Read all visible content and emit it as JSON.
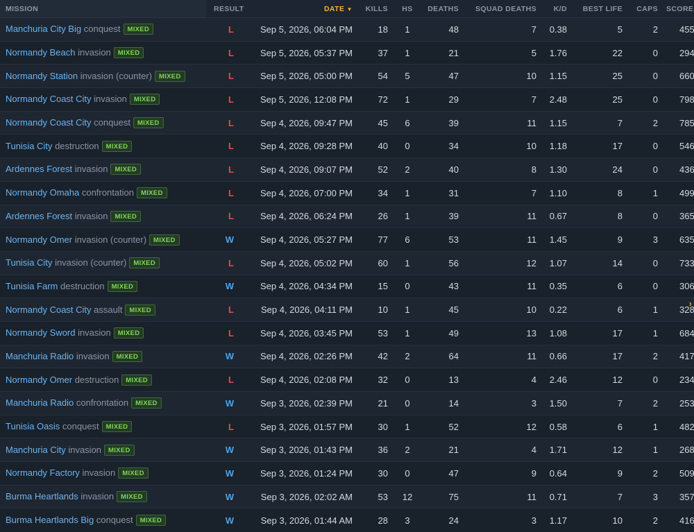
{
  "columns": {
    "mission": "MISSION",
    "result": "RESULT",
    "date": "DATE",
    "date_sort_icon": "sort-down-icon",
    "kills": "KILLS",
    "hs": "HS",
    "deaths": "DEATHS",
    "squad_deaths": "SQUAD DEATHS",
    "kd": "K/D",
    "best_life": "BEST LIFE",
    "caps": "CAPS",
    "score": "SCORE"
  },
  "badge_label": "MIXED",
  "colors": {
    "loss": "#e84b4b",
    "win": "#4da3ea",
    "accent": "#f0b232",
    "map_link": "#6cb4f0",
    "badge": "#7ed957"
  },
  "rows": [
    {
      "map": "Manchuria City Big",
      "mode": "conquest",
      "result": "L",
      "date": "Sep 5, 2026, 06:04 PM",
      "kills": "18",
      "hs": "1",
      "deaths": "48",
      "squad_deaths": "7",
      "kd": "0.38",
      "best_life": "5",
      "caps": "2",
      "score": "455"
    },
    {
      "map": "Normandy Beach",
      "mode": "invasion",
      "result": "L",
      "date": "Sep 5, 2026, 05:37 PM",
      "kills": "37",
      "hs": "1",
      "deaths": "21",
      "squad_deaths": "5",
      "kd": "1.76",
      "best_life": "22",
      "caps": "0",
      "score": "294"
    },
    {
      "map": "Normandy Station",
      "mode": "invasion (counter)",
      "result": "L",
      "date": "Sep 5, 2026, 05:00 PM",
      "kills": "54",
      "hs": "5",
      "deaths": "47",
      "squad_deaths": "10",
      "kd": "1.15",
      "best_life": "25",
      "caps": "0",
      "score": "660"
    },
    {
      "map": "Normandy Coast City",
      "mode": "invasion",
      "result": "L",
      "date": "Sep 5, 2026, 12:08 PM",
      "kills": "72",
      "hs": "1",
      "deaths": "29",
      "squad_deaths": "7",
      "kd": "2.48",
      "best_life": "25",
      "caps": "0",
      "score": "798"
    },
    {
      "map": "Normandy Coast City",
      "mode": "conquest",
      "result": "L",
      "date": "Sep 4, 2026, 09:47 PM",
      "kills": "45",
      "hs": "6",
      "deaths": "39",
      "squad_deaths": "11",
      "kd": "1.15",
      "best_life": "7",
      "caps": "2",
      "score": "785"
    },
    {
      "map": "Tunisia City",
      "mode": "destruction",
      "result": "L",
      "date": "Sep 4, 2026, 09:28 PM",
      "kills": "40",
      "hs": "0",
      "deaths": "34",
      "squad_deaths": "10",
      "kd": "1.18",
      "best_life": "17",
      "caps": "0",
      "score": "546"
    },
    {
      "map": "Ardennes Forest",
      "mode": "invasion",
      "result": "L",
      "date": "Sep 4, 2026, 09:07 PM",
      "kills": "52",
      "hs": "2",
      "deaths": "40",
      "squad_deaths": "8",
      "kd": "1.30",
      "best_life": "24",
      "caps": "0",
      "score": "436"
    },
    {
      "map": "Normandy Omaha",
      "mode": "confrontation",
      "result": "L",
      "date": "Sep 4, 2026, 07:00 PM",
      "kills": "34",
      "hs": "1",
      "deaths": "31",
      "squad_deaths": "7",
      "kd": "1.10",
      "best_life": "8",
      "caps": "1",
      "score": "499"
    },
    {
      "map": "Ardennes Forest",
      "mode": "invasion",
      "result": "L",
      "date": "Sep 4, 2026, 06:24 PM",
      "kills": "26",
      "hs": "1",
      "deaths": "39",
      "squad_deaths": "11",
      "kd": "0.67",
      "best_life": "8",
      "caps": "0",
      "score": "365"
    },
    {
      "map": "Normandy Omer",
      "mode": "invasion (counter)",
      "result": "W",
      "date": "Sep 4, 2026, 05:27 PM",
      "kills": "77",
      "hs": "6",
      "deaths": "53",
      "squad_deaths": "11",
      "kd": "1.45",
      "best_life": "9",
      "caps": "3",
      "score": "635"
    },
    {
      "map": "Tunisia City",
      "mode": "invasion (counter)",
      "result": "L",
      "date": "Sep 4, 2026, 05:02 PM",
      "kills": "60",
      "hs": "1",
      "deaths": "56",
      "squad_deaths": "12",
      "kd": "1.07",
      "best_life": "14",
      "caps": "0",
      "score": "733"
    },
    {
      "map": "Tunisia Farm",
      "mode": "destruction",
      "result": "W",
      "date": "Sep 4, 2026, 04:34 PM",
      "kills": "15",
      "hs": "0",
      "deaths": "43",
      "squad_deaths": "11",
      "kd": "0.35",
      "best_life": "6",
      "caps": "0",
      "score": "306"
    },
    {
      "map": "Normandy Coast City",
      "mode": "assault",
      "result": "L",
      "date": "Sep 4, 2026, 04:11 PM",
      "kills": "10",
      "hs": "1",
      "deaths": "45",
      "squad_deaths": "10",
      "kd": "0.22",
      "best_life": "6",
      "caps": "1",
      "score": "328"
    },
    {
      "map": "Normandy Sword",
      "mode": "invasion",
      "result": "L",
      "date": "Sep 4, 2026, 03:45 PM",
      "kills": "53",
      "hs": "1",
      "deaths": "49",
      "squad_deaths": "13",
      "kd": "1.08",
      "best_life": "17",
      "caps": "1",
      "score": "684"
    },
    {
      "map": "Manchuria Radio",
      "mode": "invasion",
      "result": "W",
      "date": "Sep 4, 2026, 02:26 PM",
      "kills": "42",
      "hs": "2",
      "deaths": "64",
      "squad_deaths": "11",
      "kd": "0.66",
      "best_life": "17",
      "caps": "2",
      "score": "417"
    },
    {
      "map": "Normandy Omer",
      "mode": "destruction",
      "result": "L",
      "date": "Sep 4, 2026, 02:08 PM",
      "kills": "32",
      "hs": "0",
      "deaths": "13",
      "squad_deaths": "4",
      "kd": "2.46",
      "best_life": "12",
      "caps": "0",
      "score": "234"
    },
    {
      "map": "Manchuria Radio",
      "mode": "confrontation",
      "result": "W",
      "date": "Sep 3, 2026, 02:39 PM",
      "kills": "21",
      "hs": "0",
      "deaths": "14",
      "squad_deaths": "3",
      "kd": "1.50",
      "best_life": "7",
      "caps": "2",
      "score": "253"
    },
    {
      "map": "Tunisia Oasis",
      "mode": "conquest",
      "result": "L",
      "date": "Sep 3, 2026, 01:57 PM",
      "kills": "30",
      "hs": "1",
      "deaths": "52",
      "squad_deaths": "12",
      "kd": "0.58",
      "best_life": "6",
      "caps": "1",
      "score": "482"
    },
    {
      "map": "Manchuria City",
      "mode": "invasion",
      "result": "W",
      "date": "Sep 3, 2026, 01:43 PM",
      "kills": "36",
      "hs": "2",
      "deaths": "21",
      "squad_deaths": "4",
      "kd": "1.71",
      "best_life": "12",
      "caps": "1",
      "score": "268"
    },
    {
      "map": "Normandy Factory",
      "mode": "invasion",
      "result": "W",
      "date": "Sep 3, 2026, 01:24 PM",
      "kills": "30",
      "hs": "0",
      "deaths": "47",
      "squad_deaths": "9",
      "kd": "0.64",
      "best_life": "9",
      "caps": "2",
      "score": "509"
    },
    {
      "map": "Burma Heartlands",
      "mode": "invasion",
      "result": "W",
      "date": "Sep 3, 2026, 02:02 AM",
      "kills": "53",
      "hs": "12",
      "deaths": "75",
      "squad_deaths": "11",
      "kd": "0.71",
      "best_life": "7",
      "caps": "3",
      "score": "357"
    },
    {
      "map": "Burma Heartlands Big",
      "mode": "conquest",
      "result": "W",
      "date": "Sep 3, 2026, 01:44 AM",
      "kills": "28",
      "hs": "3",
      "deaths": "24",
      "squad_deaths": "3",
      "kd": "1.17",
      "best_life": "10",
      "caps": "2",
      "score": "416"
    }
  ]
}
